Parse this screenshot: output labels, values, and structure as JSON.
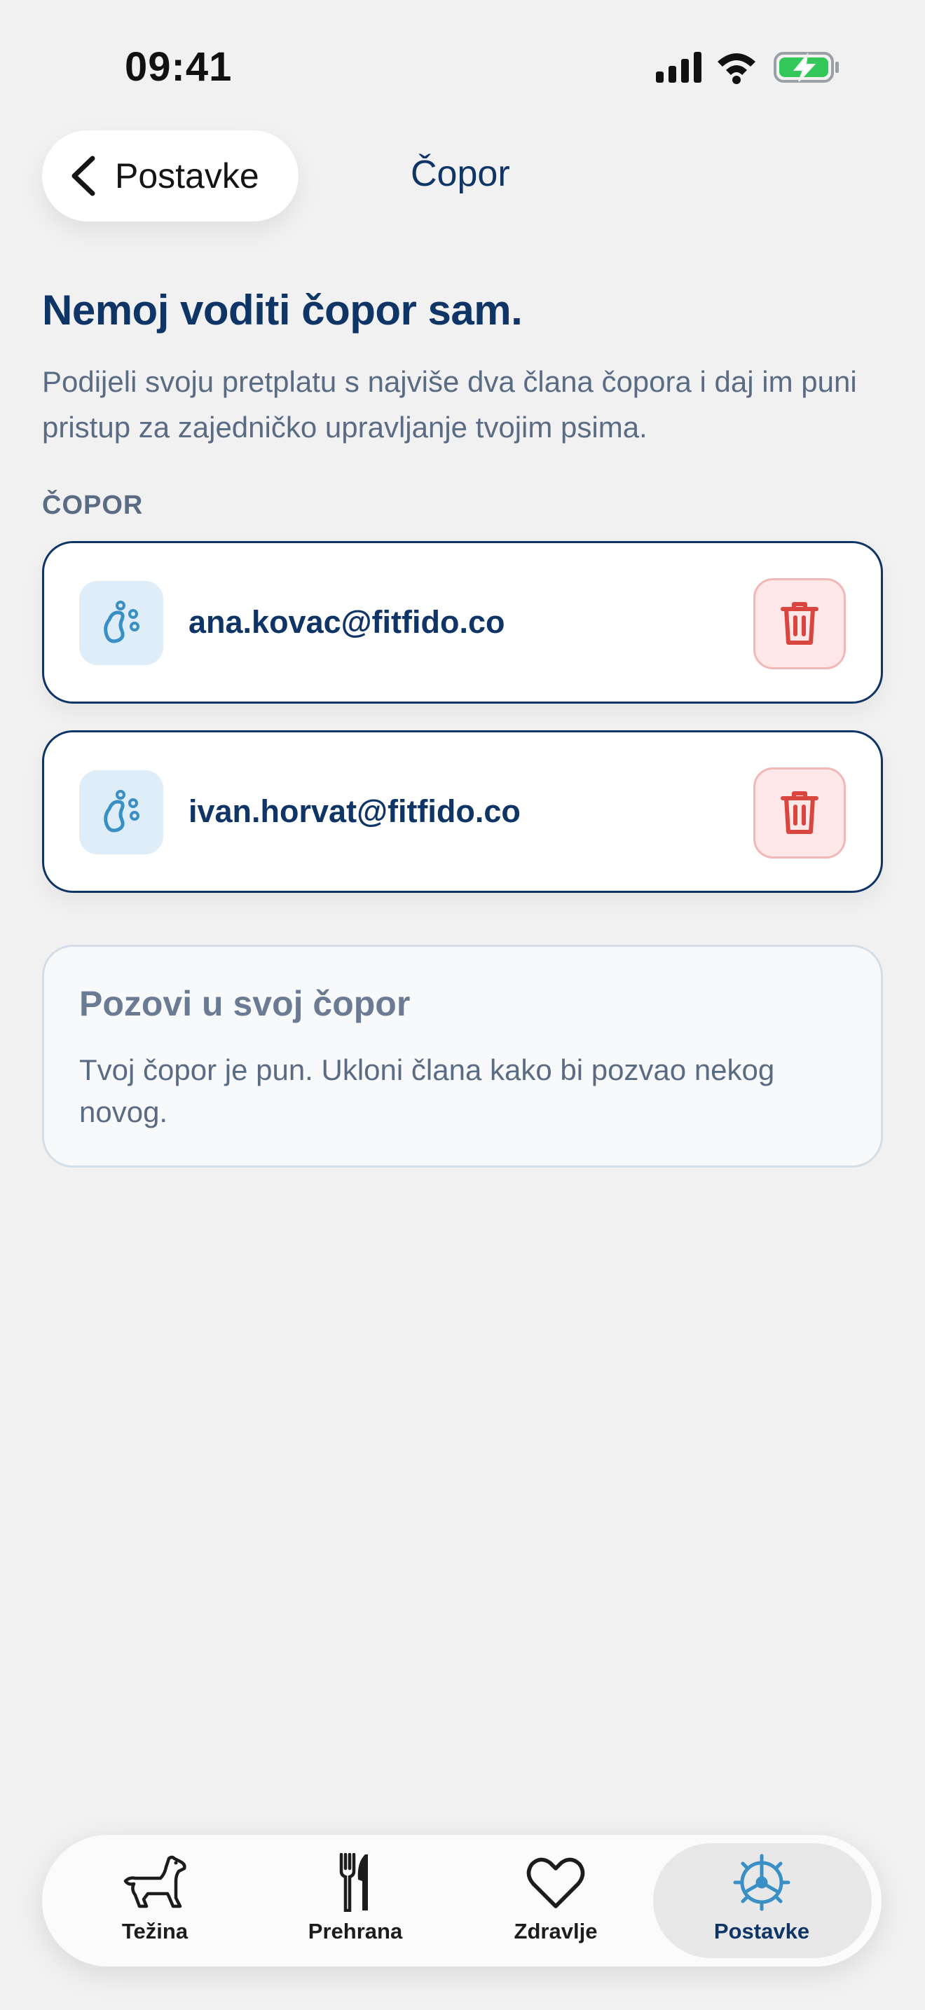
{
  "status_bar": {
    "time": "09:41"
  },
  "nav": {
    "back_label": "Postavke",
    "title": "Čopor"
  },
  "intro": {
    "headline": "Nemoj voditi čopor sam.",
    "subtitle": "Podijeli svoju pretplatu s najviše dva člana čopora i daj im puni pristup za zajedničko upravljanje tvojim psima."
  },
  "pack": {
    "section_label": "ČOPOR",
    "members": [
      {
        "email": "ana.kovac@fitfido.co",
        "icon": "paw-icon",
        "action_icon": "trash-icon"
      },
      {
        "email": "ivan.horvat@fitfido.co",
        "icon": "paw-icon",
        "action_icon": "trash-icon"
      }
    ]
  },
  "invite": {
    "title": "Pozovi u svoj čopor",
    "text": "Tvoj čopor je pun. Ukloni člana kako bi pozvao nekog novog."
  },
  "tab_bar": {
    "tabs": [
      {
        "label": "Težina",
        "icon": "dog-icon"
      },
      {
        "label": "Prehrana",
        "icon": "fork-knife-icon"
      },
      {
        "label": "Zdravlje",
        "icon": "heart-icon"
      },
      {
        "label": "Postavke",
        "icon": "gear-icon",
        "selected": true
      }
    ]
  },
  "colors": {
    "primary": "#0f3566",
    "muted_text": "#5a6b84",
    "paw_blue": "#3a8fc4",
    "danger": "#d9463f",
    "danger_bg": "#fde7e7",
    "background": "#f1f1f2"
  }
}
